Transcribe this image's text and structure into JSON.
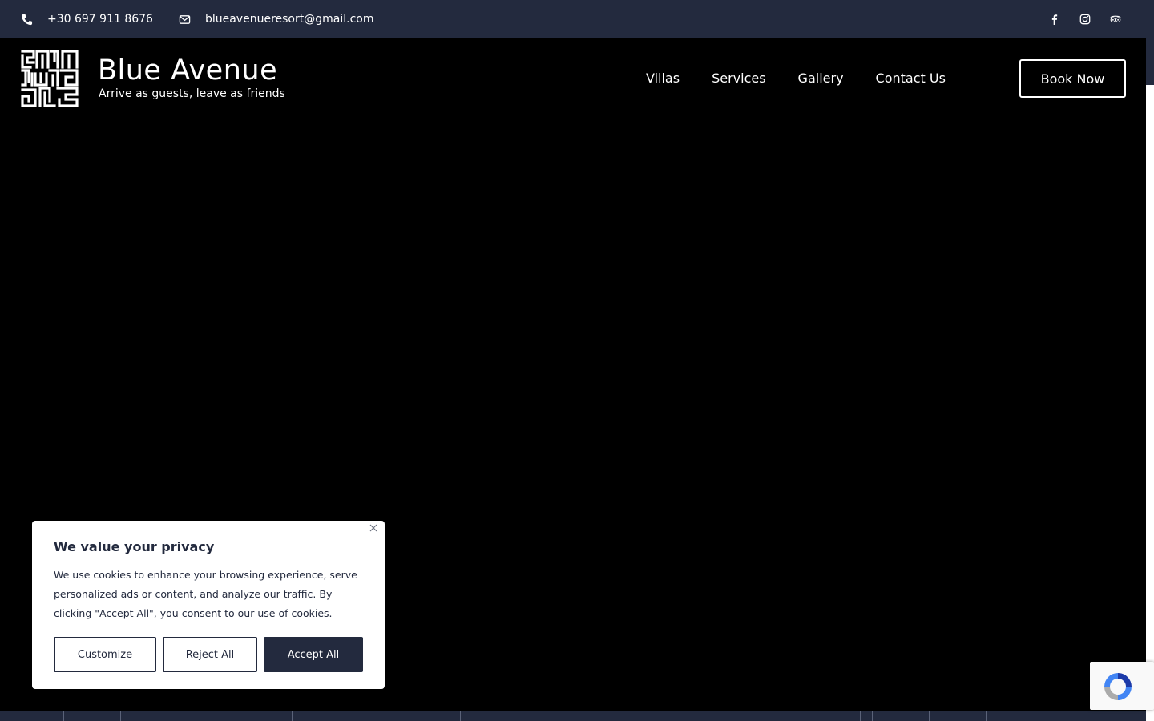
{
  "topbar": {
    "phone": "+30 697 911 8676",
    "email": "blueavenueresort@gmail.com",
    "social_icons": [
      "facebook-icon",
      "instagram-icon",
      "tripadvisor-icon"
    ]
  },
  "header": {
    "brand_name": "Blue Avenue",
    "brand_tagline": "Arrive as guests, leave as friends",
    "nav": [
      {
        "label": "Villas"
      },
      {
        "label": "Services"
      },
      {
        "label": "Gallery"
      },
      {
        "label": "Contact Us"
      }
    ],
    "book_label": "Book Now"
  },
  "cookie": {
    "title": "We value your privacy",
    "body": "We use cookies to enhance your browsing experience, serve personalized ads or content, and analyze our traffic. By clicking \"Accept All\", you consent to our use of cookies.",
    "customize_label": "Customize",
    "reject_label": "Reject All",
    "accept_label": "Accept All"
  },
  "colors": {
    "navy": "#232a3e",
    "background": "#000000",
    "white": "#ffffff"
  }
}
